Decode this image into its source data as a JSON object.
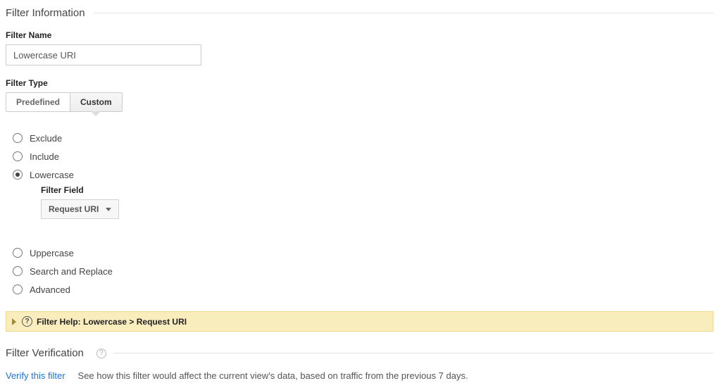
{
  "filter_info": {
    "section_title": "Filter Information",
    "name_label": "Filter Name",
    "name_value": "Lowercase URI",
    "type_label": "Filter Type",
    "segments": {
      "predefined": "Predefined",
      "custom": "Custom"
    },
    "radios": {
      "exclude": "Exclude",
      "include": "Include",
      "lowercase": "Lowercase",
      "uppercase": "Uppercase",
      "search_replace": "Search and Replace",
      "advanced": "Advanced"
    },
    "filter_field_label": "Filter Field",
    "filter_field_value": "Request URI",
    "help_bar": {
      "prefix": "Filter Help: ",
      "path1": "Lowercase",
      "sep": "  >  ",
      "path2": "Request URI"
    }
  },
  "filter_verification": {
    "section_title": "Filter Verification",
    "verify_link": "Verify this filter",
    "description": "See how this filter would affect the current view's data, based on traffic from the previous 7 days."
  }
}
